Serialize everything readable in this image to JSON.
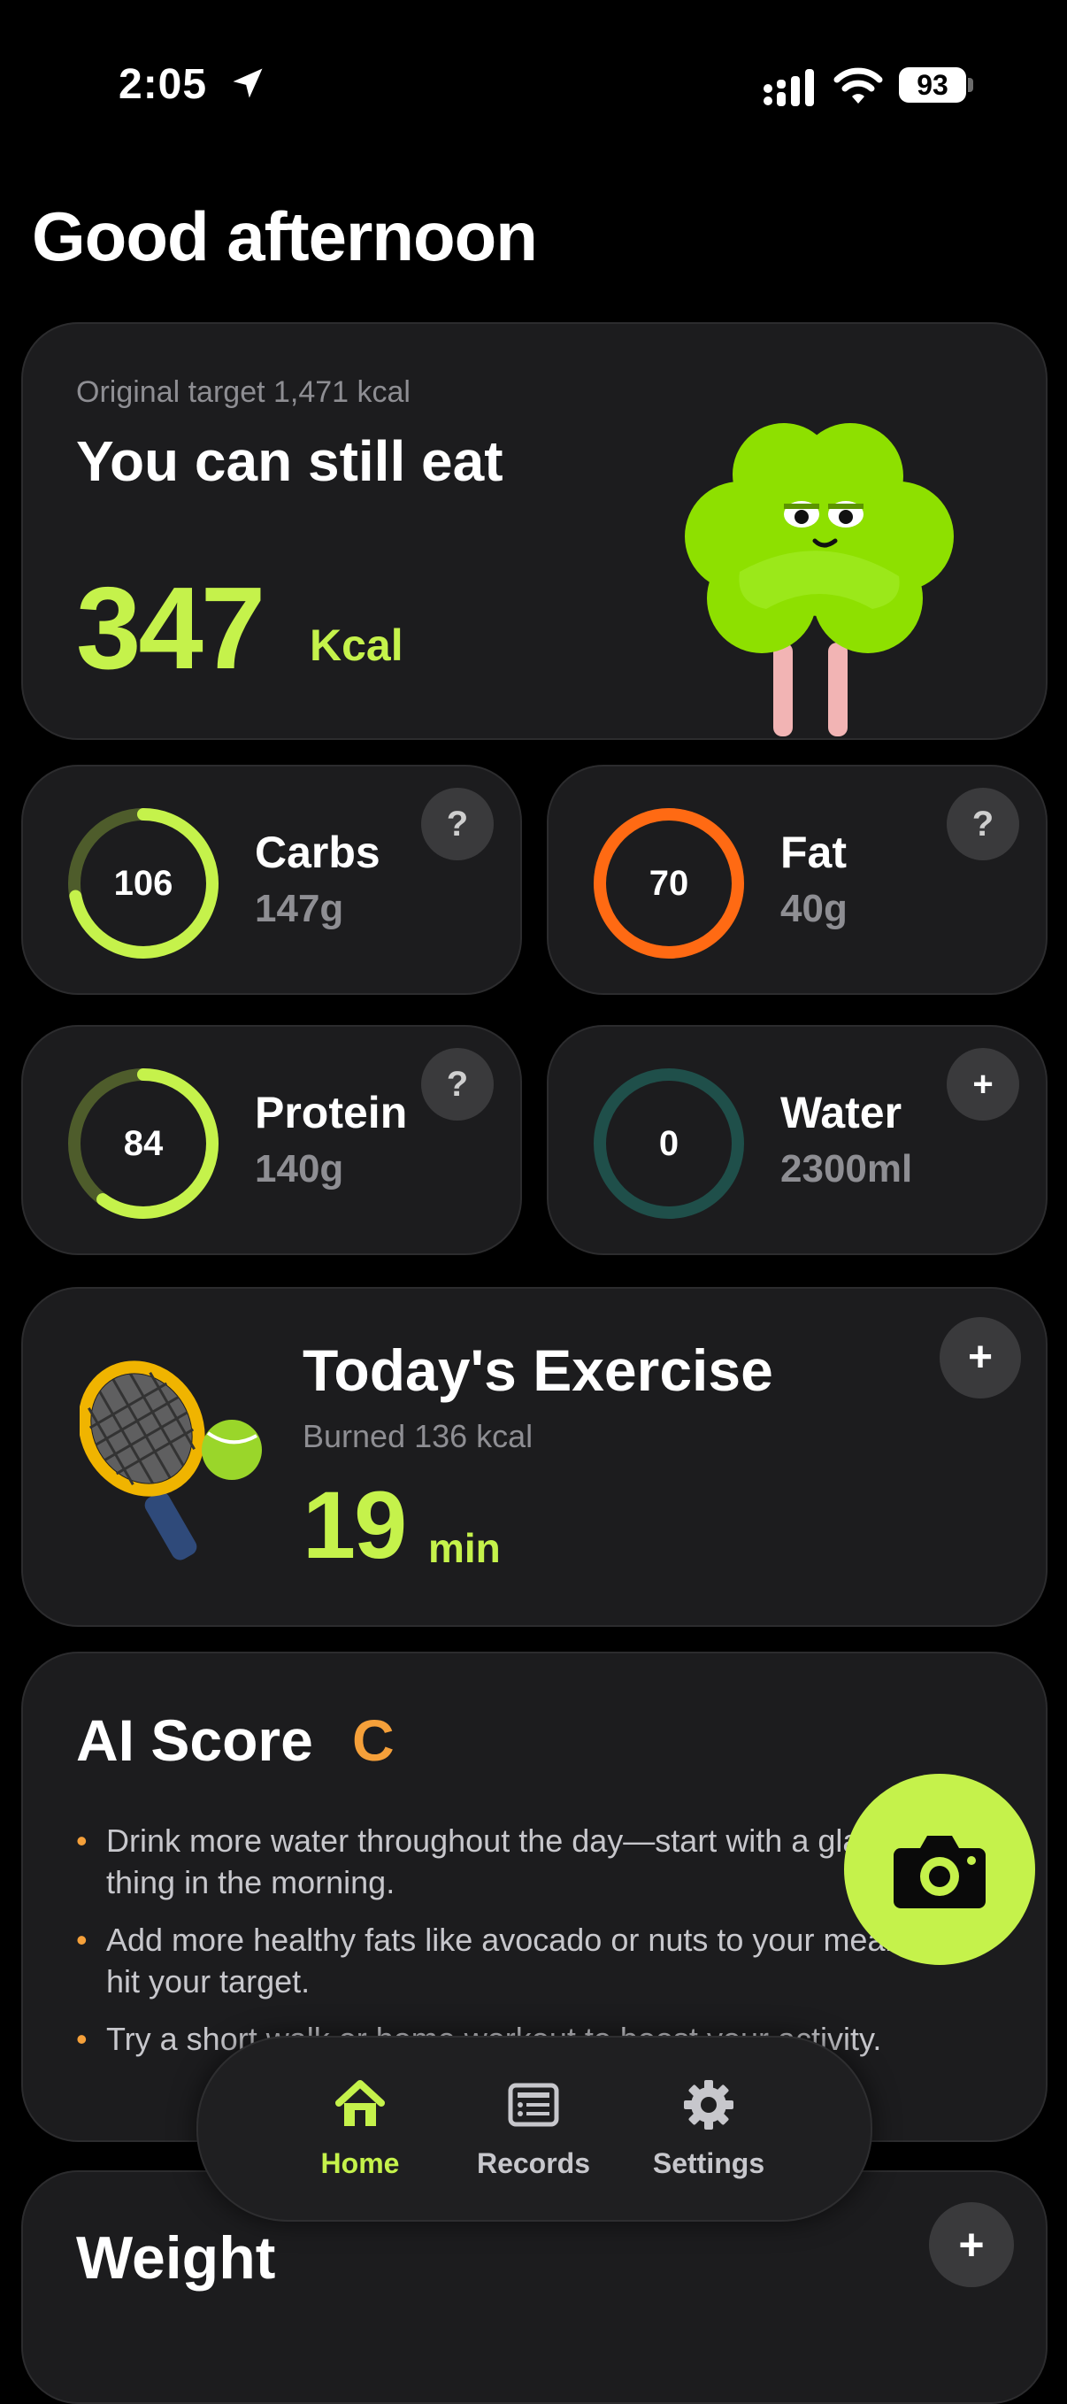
{
  "status_bar": {
    "time": "2:05",
    "battery": "93"
  },
  "greeting": "Good afternoon",
  "calorie_card": {
    "original_target": "Original target 1,471 kcal",
    "headline": "You can still eat",
    "remaining_value": "347",
    "remaining_unit": "Kcal"
  },
  "macros": {
    "carbs": {
      "ring_value": "106",
      "name": "Carbs",
      "amount": "147g",
      "button": "?",
      "progress": 0.72,
      "color": "#c5f24b"
    },
    "fat": {
      "ring_value": "70",
      "name": "Fat",
      "amount": "40g",
      "button": "?",
      "progress": 1.0,
      "color": "#ff6a13"
    },
    "protein": {
      "ring_value": "84",
      "name": "Protein",
      "amount": "140g",
      "button": "?",
      "progress": 0.6,
      "color": "#c5f24b"
    },
    "water": {
      "ring_value": "0",
      "name": "Water",
      "amount": "2300ml",
      "button": "+",
      "progress": 0.0,
      "color": "#1f4f4a"
    }
  },
  "exercise": {
    "title": "Today's Exercise",
    "burned": "Burned 136 kcal",
    "value": "19",
    "unit": "min",
    "button": "+"
  },
  "ai_score": {
    "title": "AI Score",
    "grade": "C",
    "tips": [
      "Drink more water throughout the day—start with a glass first thing in the morning.",
      "Add more healthy fats like avocado or nuts to your meals to hit your target.",
      "Try a short walk or home workout to boost your activity."
    ]
  },
  "weight": {
    "title": "Weight",
    "button": "+"
  },
  "tabs": [
    {
      "label": "Home",
      "icon": "home-icon",
      "active": true
    },
    {
      "label": "Records",
      "icon": "records-icon",
      "active": false
    },
    {
      "label": "Settings",
      "icon": "gear-icon",
      "active": false
    }
  ],
  "colors": {
    "accent": "#c5f24b",
    "fat": "#ff6a13",
    "grade": "#f5a03a",
    "card": "#1c1c1e"
  }
}
